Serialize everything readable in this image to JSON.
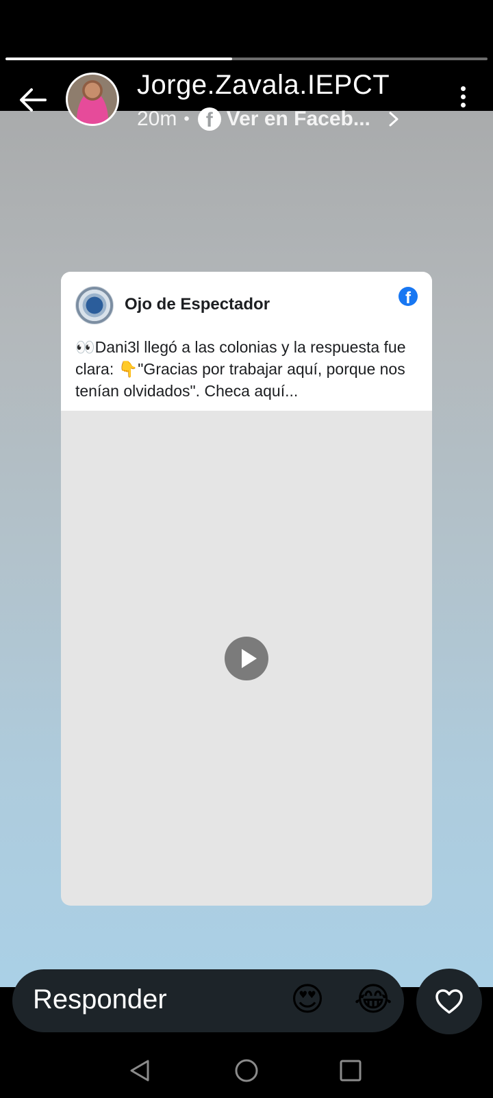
{
  "story": {
    "progress_fraction": 0.47,
    "username": "Jorge.Zavala.IEPCT",
    "time_ago": "20m",
    "separator": "•",
    "source_link": "Ver en Faceb...",
    "background_top": "#a9abac",
    "background_bottom": "#aad0e6"
  },
  "icons": {
    "back": "arrow-left",
    "more": "vertical-ellipsis",
    "facebook": "facebook-logo",
    "play": "play-circle",
    "like": "heart-outline"
  },
  "card": {
    "page_name": "Ojo de Espectador",
    "fb_glyph": "f",
    "text": "👀Dani3l llegó a las colonias y la respuesta fue clara:  👇\"Gracias por trabajar aquí, porque nos tenían olvidados\". Checa aquí..."
  },
  "reply": {
    "placeholder": "Responder",
    "emoji_1": "😍",
    "emoji_2": "😂"
  },
  "colors": {
    "facebook_blue": "#1877f2",
    "pill_bg": "#1d2429"
  }
}
